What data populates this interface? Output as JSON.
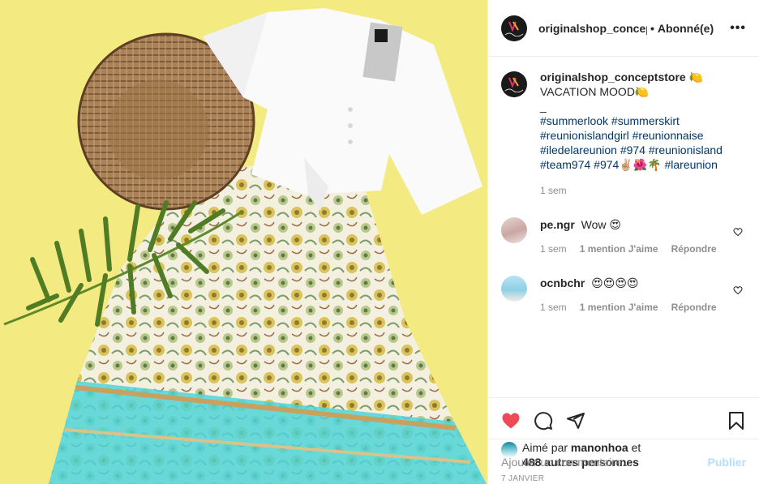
{
  "header": {
    "username": "originalshop_concept",
    "separator": "•",
    "follow_status": "Abonné(e)",
    "more_label": "•••"
  },
  "caption": {
    "username": "originalshop_conceptstore",
    "username_emoji": "🍋",
    "line1": "VACATION MOOD🍋",
    "line2": "_",
    "hashtags_line1": "#summerlook #summerskirt",
    "hashtags_line2": "#reunionislandgirl #reunionnaise",
    "hashtags_line3": "#iledelareunion #974 #reunionisland",
    "hashtags_line4": "#team974 #974✌🏼🌺🌴 #lareunion",
    "time": "1 sem"
  },
  "comments": [
    {
      "username": "pe.ngr",
      "text": "Wow 😍",
      "time": "1 sem",
      "likes": "1 mention J'aime",
      "reply": "Répondre"
    },
    {
      "username": "ocnbchr",
      "text": "😍😍😍😍",
      "time": "1 sem",
      "likes": "1 mention J'aime",
      "reply": "Répondre"
    }
  ],
  "likes": {
    "prefix": "Aimé par",
    "user": "manonhoa",
    "connector": "et",
    "others": "488 autres personnes"
  },
  "date": "7 JANVIER",
  "add_comment": {
    "placeholder": "Ajouter un commentaire...",
    "publish": "Publier"
  },
  "icons": {
    "like": "heart-filled-icon",
    "comment": "comment-icon",
    "share": "paper-plane-icon",
    "save": "bookmark-icon",
    "more": "ellipsis-icon"
  },
  "colors": {
    "like_red": "#ed4956",
    "link_blue": "#00376b",
    "publish_disabled": "#b2dffc",
    "photo_background": "#f4ea82"
  }
}
